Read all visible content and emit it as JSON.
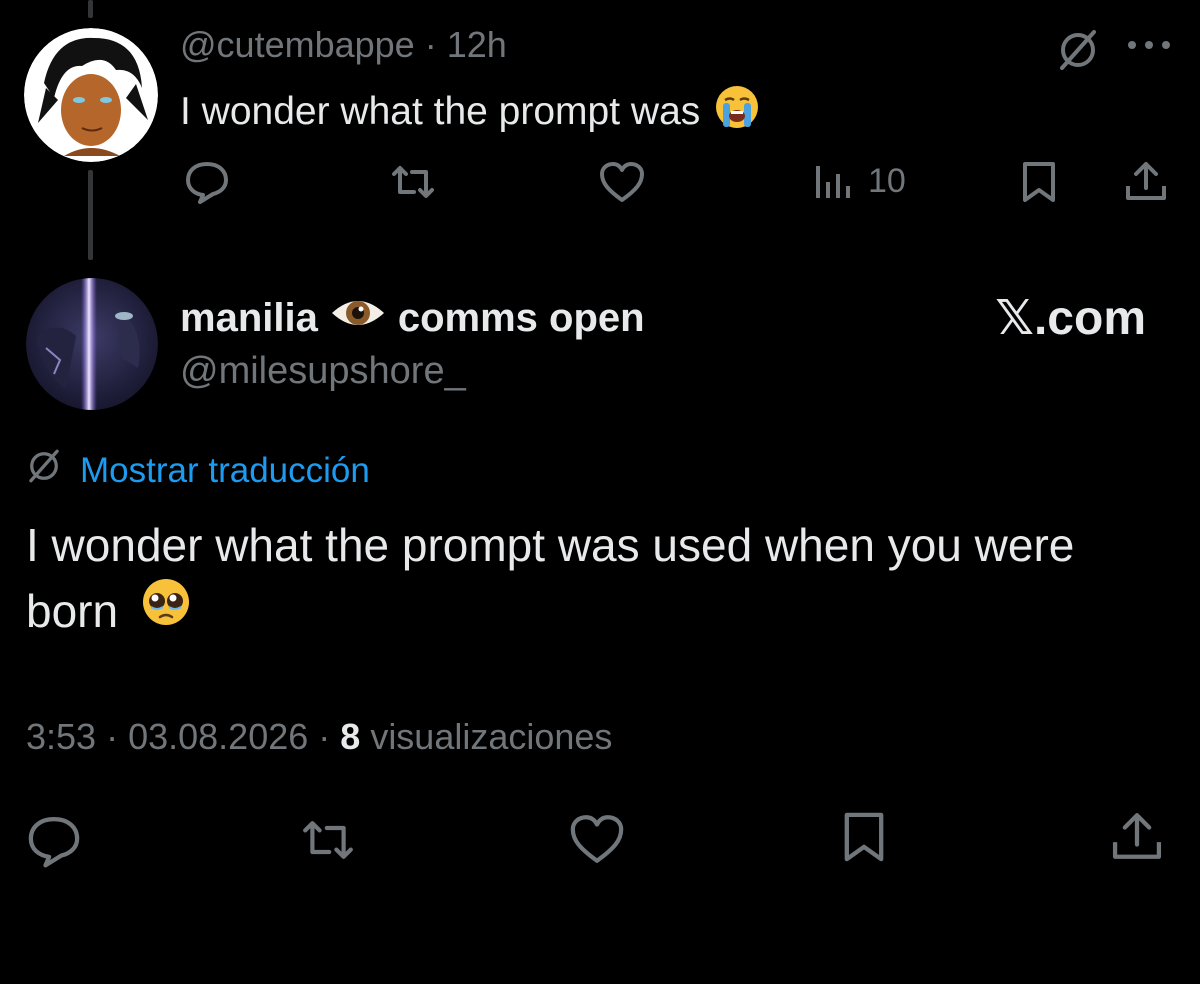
{
  "reply": {
    "handle": "@cutembappe",
    "separator": " · ",
    "time": "12h",
    "text": "I wonder what the prompt was",
    "text_emoji": "loudly-crying-face",
    "views": "10"
  },
  "main": {
    "display_name": "manilia",
    "name_emoji": "eye",
    "name_suffix": "comms open",
    "handle": "@milesupshore_",
    "brand": "𝕏.com",
    "translate_label": "Mostrar traducción",
    "text": "I wonder what the prompt was used when you were born",
    "text_emoji": "pleading-face",
    "time": "3:53",
    "date": "03.08.2026",
    "views_count": "8",
    "views_label": "visualizaciones"
  },
  "colors": {
    "background": "#000000",
    "text_primary": "#e7e9ea",
    "text_secondary": "#71767b",
    "link": "#1d9bf0"
  }
}
